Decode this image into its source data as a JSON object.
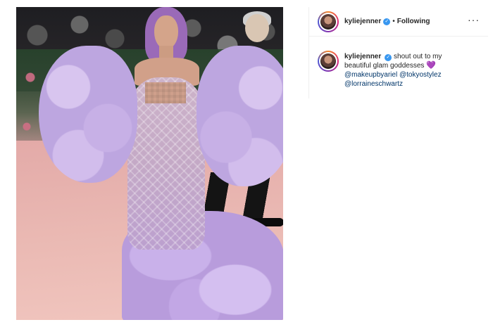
{
  "post": {
    "username": "kyliejenner",
    "verified_icon": "verified-badge-icon",
    "separator": "•",
    "follow_status": "Following",
    "more_icon": "more-options-icon",
    "more_glyph": "···"
  },
  "comment": {
    "username": "kyliejenner",
    "text_part1": "shout out to my beautiful glam goddesses",
    "heart": "💜",
    "mentions": [
      "@makeupbyariel",
      "@tokyostylez",
      "@lorraineschwartz"
    ]
  },
  "colors": {
    "verified": "#3897f0",
    "mention_link": "#003569",
    "gown_lavender": "#bda6e0"
  }
}
